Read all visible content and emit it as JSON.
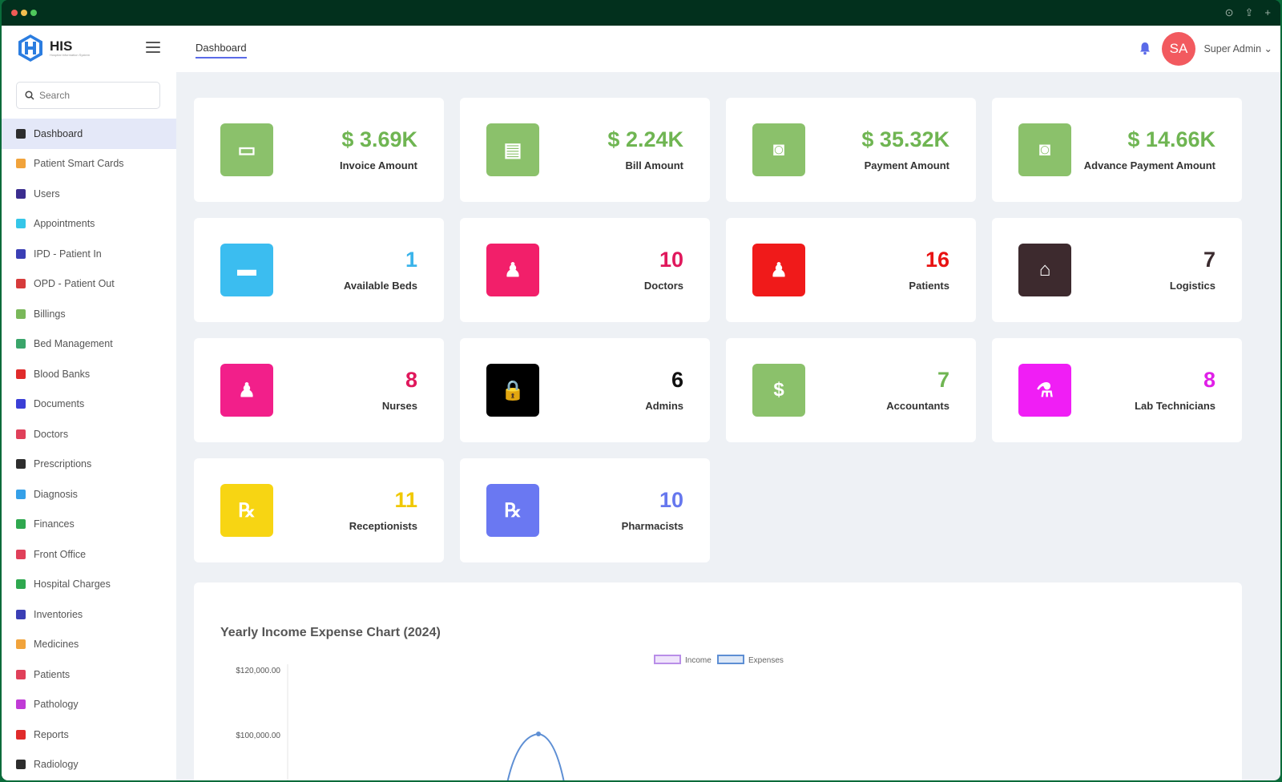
{
  "window": {
    "dots": [
      "#ef5b55",
      "#f3be4f",
      "#4ec85c"
    ]
  },
  "brand": {
    "name": "HIS",
    "tagline": "Hospital Information System"
  },
  "search": {
    "placeholder": "Search"
  },
  "sidebar": {
    "items": [
      {
        "label": "Dashboard",
        "icon": "dashboard-icon",
        "color": "#2d2d2d",
        "active": true
      },
      {
        "label": "Patient Smart Cards",
        "icon": "smart-card-icon",
        "color": "#f1a33b"
      },
      {
        "label": "Users",
        "icon": "users-icon",
        "color": "#3b2d8f"
      },
      {
        "label": "Appointments",
        "icon": "calendar-icon",
        "color": "#35c6e8"
      },
      {
        "label": "IPD - Patient In",
        "icon": "patient-in-icon",
        "color": "#3b3fb5"
      },
      {
        "label": "OPD - Patient Out",
        "icon": "stethoscope-icon",
        "color": "#d63b3b"
      },
      {
        "label": "Billings",
        "icon": "bill-icon",
        "color": "#7ab85a"
      },
      {
        "label": "Bed Management",
        "icon": "bed-icon",
        "color": "#3aa56a"
      },
      {
        "label": "Blood Banks",
        "icon": "blood-drop-icon",
        "color": "#e02b2b"
      },
      {
        "label": "Documents",
        "icon": "document-icon",
        "color": "#3b3fd6"
      },
      {
        "label": "Doctors",
        "icon": "doctor-icon",
        "color": "#e0405a"
      },
      {
        "label": "Prescriptions",
        "icon": "prescription-icon",
        "color": "#2d2d2d"
      },
      {
        "label": "Diagnosis",
        "icon": "diagnosis-icon",
        "color": "#35a0e8"
      },
      {
        "label": "Finances",
        "icon": "money-icon",
        "color": "#2fa84f"
      },
      {
        "label": "Front Office",
        "icon": "building-icon",
        "color": "#e0405a"
      },
      {
        "label": "Hospital Charges",
        "icon": "coins-icon",
        "color": "#2fa84f"
      },
      {
        "label": "Inventories",
        "icon": "inventory-icon",
        "color": "#3b3fb5"
      },
      {
        "label": "Medicines",
        "icon": "pills-icon",
        "color": "#f1a33b"
      },
      {
        "label": "Patients",
        "icon": "patient-icon",
        "color": "#e0405a"
      },
      {
        "label": "Pathology",
        "icon": "flask-icon",
        "color": "#c03bd6"
      },
      {
        "label": "Reports",
        "icon": "report-icon",
        "color": "#e02b2b"
      },
      {
        "label": "Radiology",
        "icon": "radiology-icon",
        "color": "#2d2d2d"
      }
    ]
  },
  "topbar": {
    "tab": "Dashboard",
    "avatar_initials": "SA",
    "user_name": "Super Admin"
  },
  "stats": [
    {
      "value": "$ 3.69K",
      "label": "Invoice Amount",
      "color": "#6fb552",
      "icon_bg": "#8bc16b",
      "icon": "invoice-icon"
    },
    {
      "value": "$ 2.24K",
      "label": "Bill Amount",
      "color": "#6fb552",
      "icon_bg": "#8bc16b",
      "icon": "bill-icon"
    },
    {
      "value": "$ 35.32K",
      "label": "Payment Amount",
      "color": "#6fb552",
      "icon_bg": "#8bc16b",
      "icon": "money-icon"
    },
    {
      "value": "$ 14.66K",
      "label": "Advance Payment Amount",
      "color": "#6fb552",
      "icon_bg": "#8bc16b",
      "icon": "money-stack-icon"
    },
    {
      "value": "1",
      "label": "Available Beds",
      "color": "#3bb4ea",
      "icon_bg": "#3bbdf0",
      "icon": "bed-icon"
    },
    {
      "value": "10",
      "label": "Doctors",
      "color": "#e0185c",
      "icon_bg": "#f21f6a",
      "icon": "doctor-icon"
    },
    {
      "value": "16",
      "label": "Patients",
      "color": "#e81313",
      "icon_bg": "#f01a1a",
      "icon": "patient-icon"
    },
    {
      "value": "7",
      "label": "Logistics",
      "color": "#3a2a2e",
      "icon_bg": "#3d2a2e",
      "icon": "logistics-icon"
    },
    {
      "value": "8",
      "label": "Nurses",
      "color": "#e0185c",
      "icon_bg": "#f21f8a",
      "icon": "nurse-icon"
    },
    {
      "value": "6",
      "label": "Admins",
      "color": "#111111",
      "icon_bg": "#000000",
      "icon": "lock-icon"
    },
    {
      "value": "7",
      "label": "Accountants",
      "color": "#6fb552",
      "icon_bg": "#8bc16b",
      "icon": "accountant-icon"
    },
    {
      "value": "8",
      "label": "Lab Technicians",
      "color": "#e020e8",
      "icon_bg": "#f01ef5",
      "icon": "lab-icon"
    },
    {
      "value": "11",
      "label": "Receptionists",
      "color": "#f0c800",
      "icon_bg": "#f7d513",
      "icon": "rx-icon"
    },
    {
      "value": "10",
      "label": "Pharmacists",
      "color": "#6677ee",
      "icon_bg": "#6a78f2",
      "icon": "rx-icon"
    }
  ],
  "chart": {
    "title": "Yearly Income Expense Chart (2024)",
    "legend": [
      "Income",
      "Expenses"
    ],
    "income_color": "#b98ee8",
    "expense_color": "#5e8fd4",
    "yticks": [
      "$120,000.00",
      "$100,000.00"
    ]
  },
  "chart_data": {
    "type": "line",
    "title": "Yearly Income Expense Chart (2024)",
    "series": [
      {
        "name": "Income",
        "values": []
      },
      {
        "name": "Expenses",
        "values": [
          104000
        ]
      }
    ],
    "ylim": [
      96000,
      120000
    ],
    "yticks": [
      120000,
      100000
    ],
    "legend": "top-center",
    "grid": false
  }
}
